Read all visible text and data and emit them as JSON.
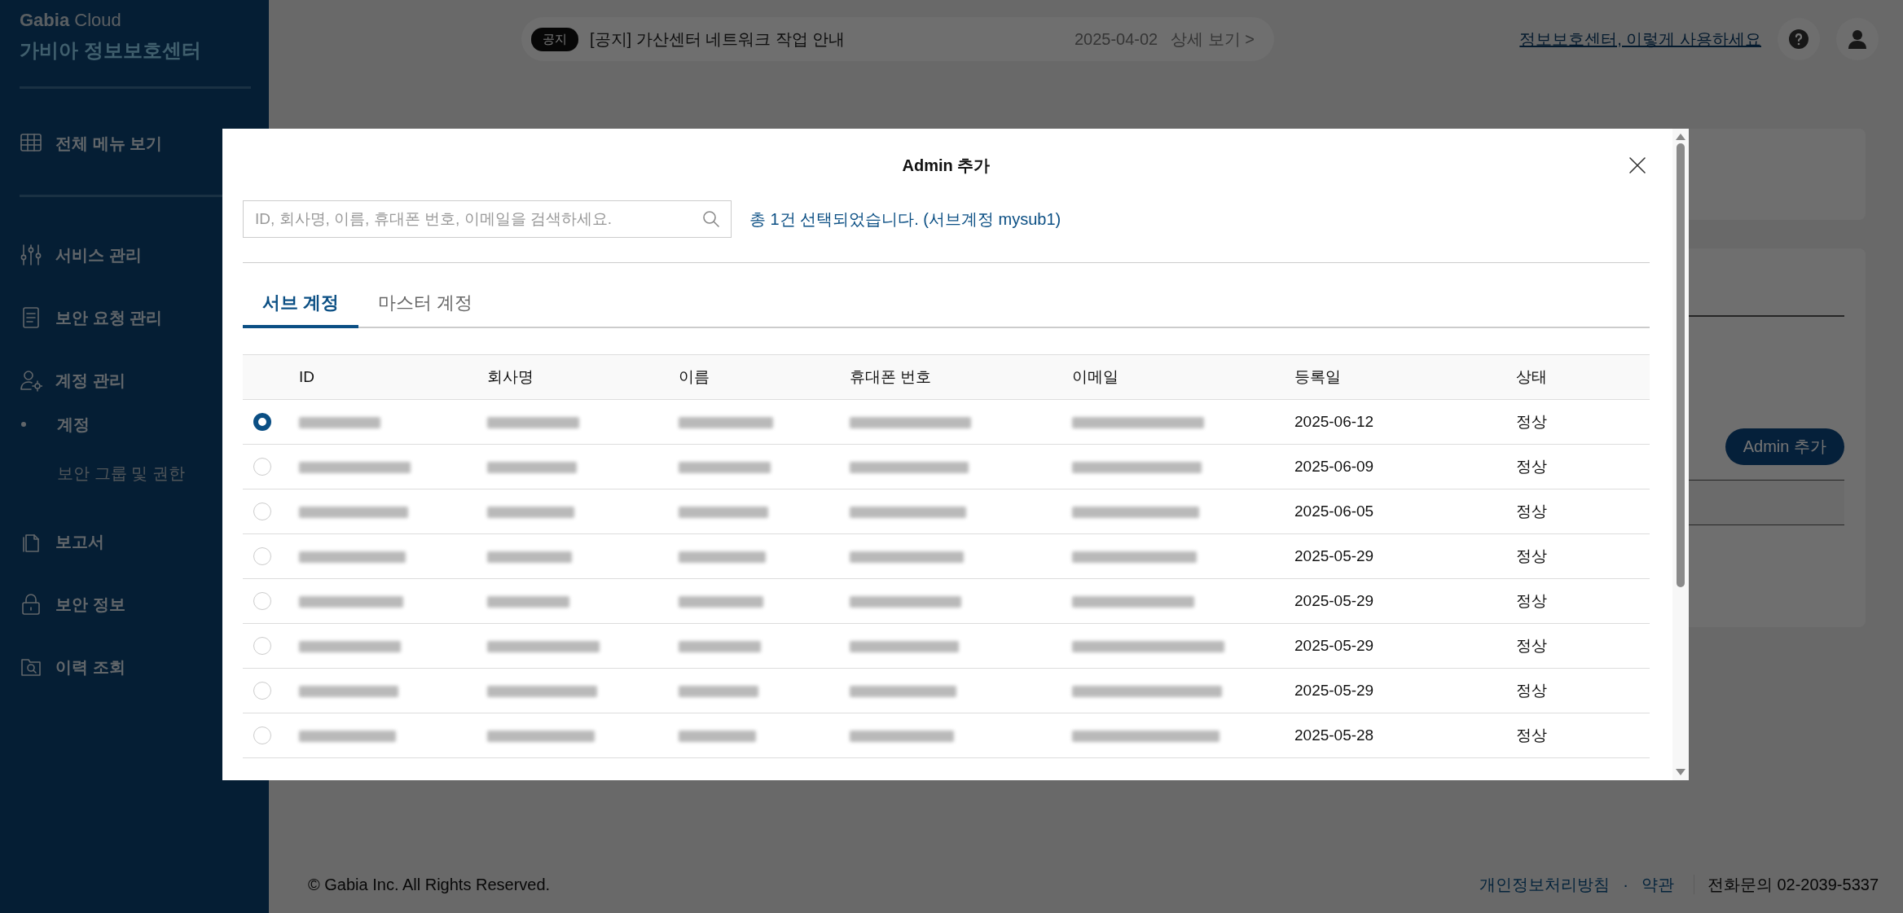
{
  "sidebar": {
    "brand": "**Gabia** Cloud",
    "title": "가비아 정보보호센터",
    "all_menu": "전체 메뉴 보기",
    "items": [
      {
        "kind": "sliders",
        "label": "서비스 관리"
      },
      {
        "kind": "document",
        "label": "보안 요청 관리"
      },
      {
        "kind": "user-gear",
        "label": "계정 관리",
        "children": [
          {
            "label": "계정",
            "selected": true
          },
          {
            "label": "보안 그룹 및 권한",
            "selected": false
          }
        ]
      },
      {
        "kind": "copy",
        "label": "보고서"
      },
      {
        "kind": "lock",
        "label": "보안 정보"
      },
      {
        "kind": "folder-search",
        "label": "이력 조회"
      }
    ]
  },
  "top_bar": {
    "notice": {
      "badge": "공지",
      "text": "[공지] 가산센터 네트워크 작업 안내",
      "date": "2025-04-02",
      "link": "상세 보기 >"
    },
    "help_link": "정보보호센터, 이렇게 사용하세요"
  },
  "background": {
    "button": "Admin 추가"
  },
  "modal": {
    "title": "Admin 추가",
    "search": {
      "placeholder": "ID, 회사명, 이름, 휴대폰 번호, 이메일을 검색하세요."
    },
    "selection_summary": "총 1건 선택되었습니다. (서브계정 mysub1)",
    "tabs": [
      {
        "label": "서브 계정",
        "selected": true
      },
      {
        "label": "마스터 계정",
        "selected": false
      }
    ],
    "table": {
      "columns": [
        "ID",
        "회사명",
        "이름",
        "휴대폰 번호",
        "이메일",
        "등록일",
        "상태"
      ],
      "rows": [
        {
          "selected": true,
          "registered": "2025-06-12",
          "status": "정상"
        },
        {
          "selected": false,
          "registered": "2025-06-09",
          "status": "정상"
        },
        {
          "selected": false,
          "registered": "2025-06-05",
          "status": "정상"
        },
        {
          "selected": false,
          "registered": "2025-05-29",
          "status": "정상"
        },
        {
          "selected": false,
          "registered": "2025-05-29",
          "status": "정상"
        },
        {
          "selected": false,
          "registered": "2025-05-29",
          "status": "정상"
        },
        {
          "selected": false,
          "registered": "2025-05-29",
          "status": "정상"
        },
        {
          "selected": false,
          "registered": "2025-05-28",
          "status": "정상"
        }
      ]
    }
  },
  "footer": {
    "copyright": "© Gabia Inc. All Rights Reserved.",
    "links": [
      "개인정보처리방침",
      "약관"
    ],
    "separator": "·",
    "phone": "전화문의 02-2039-5337"
  }
}
